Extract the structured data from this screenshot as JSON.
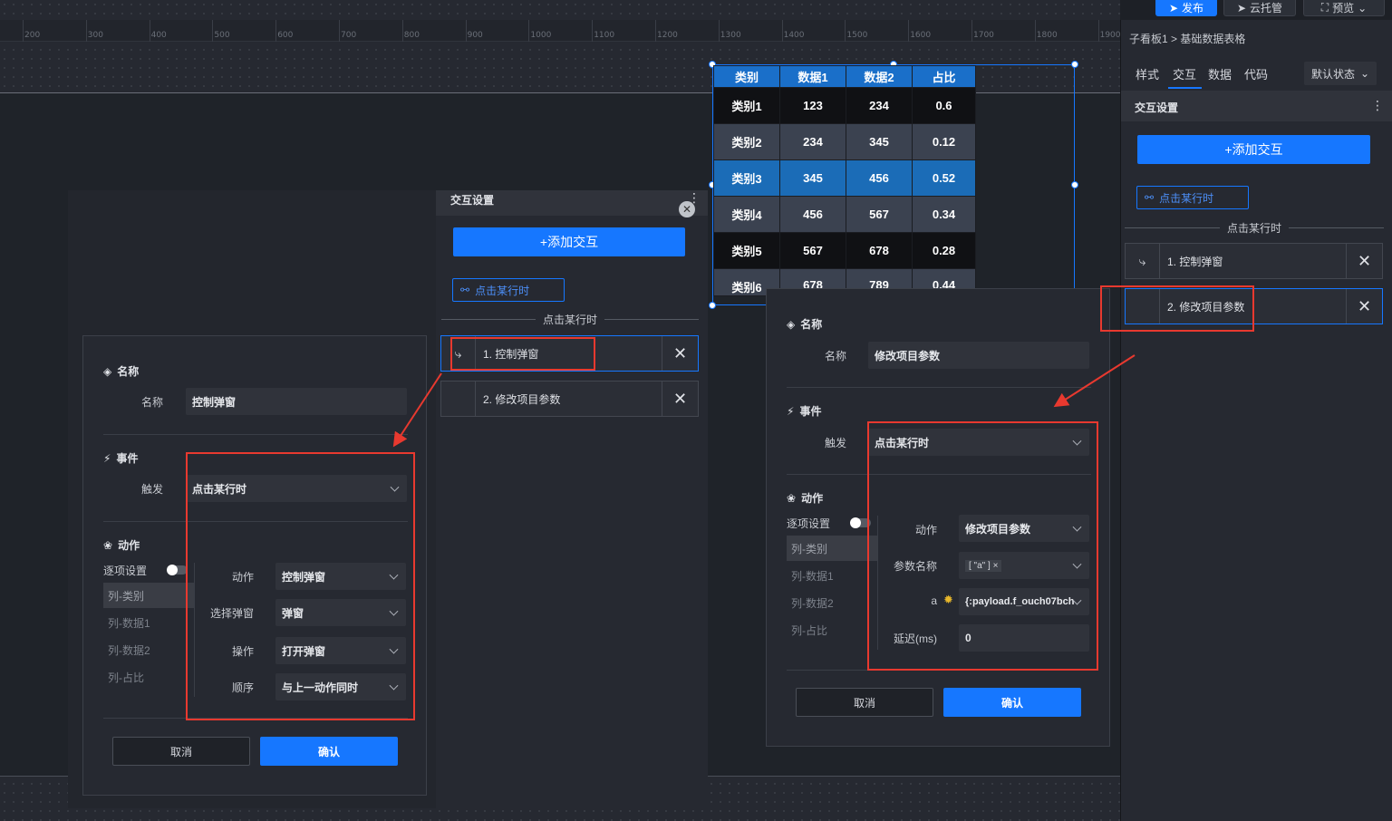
{
  "topbar": {
    "publish": "发布",
    "cloud_host": "云托管",
    "preview": "预览"
  },
  "ruler": {
    "ticks": [
      "200",
      "300",
      "400",
      "500",
      "600",
      "700",
      "800",
      "900",
      "1000",
      "1100",
      "1200",
      "1300",
      "1400",
      "1500",
      "1600",
      "1700",
      "1800",
      "1900"
    ]
  },
  "table": {
    "headers": [
      "类别",
      "数据1",
      "数据2",
      "占比"
    ],
    "rows": [
      [
        "类别1",
        "123",
        "234",
        "0.6"
      ],
      [
        "类别2",
        "234",
        "345",
        "0.12"
      ],
      [
        "类别3",
        "345",
        "456",
        "0.52"
      ],
      [
        "类别4",
        "456",
        "567",
        "0.34"
      ],
      [
        "类别5",
        "567",
        "678",
        "0.28"
      ],
      [
        "类别6",
        "678",
        "789",
        "0.44"
      ]
    ],
    "header_color": "#1a6fc9",
    "row_colors": [
      "#101114",
      "#3b4250",
      "#1b6cb7",
      "#3b4250",
      "#101114",
      "#3b4250"
    ]
  },
  "right_panel": {
    "breadcrumb_parent": "子看板1",
    "breadcrumb_sep": ">",
    "breadcrumb_current": "基础数据表格",
    "tabs": [
      "样式",
      "交互",
      "数据",
      "代码"
    ],
    "active_tab": "交互",
    "state_select": "默认状态",
    "section_title": "交互设置",
    "add_button": "+添加交互",
    "trigger_chip": "点击某行时",
    "group_label": "点击某行时",
    "items": [
      "1. 控制弹窗",
      "2. 修改项目参数"
    ]
  },
  "mid_panel": {
    "section_title": "交互设置",
    "add_button": "+添加交互",
    "trigger_chip": "点击某行时",
    "group_label": "点击某行时",
    "items": [
      "1. 控制弹窗",
      "2. 修改项目参数"
    ]
  },
  "dialog_left": {
    "name_section": "名称",
    "name_label": "名称",
    "name_value": "控制弹窗",
    "event_section": "事件",
    "trigger_label": "触发",
    "trigger_value": "点击某行时",
    "action_section": "动作",
    "per_item_label": "逐项设置",
    "columns": [
      "列-类别",
      "列-数据1",
      "列-数据2",
      "列-占比"
    ],
    "rows": [
      {
        "label": "动作",
        "value": "控制弹窗"
      },
      {
        "label": "选择弹窗",
        "value": "弹窗"
      },
      {
        "label": "操作",
        "value": "打开弹窗"
      },
      {
        "label": "顺序",
        "value": "与上一动作同时"
      }
    ],
    "cancel": "取消",
    "ok": "确认"
  },
  "dialog_right": {
    "name_section": "名称",
    "name_label": "名称",
    "name_value": "修改项目参数",
    "event_section": "事件",
    "trigger_label": "触发",
    "trigger_value": "点击某行时",
    "action_section": "动作",
    "per_item_label": "逐项设置",
    "columns": [
      "列-类别",
      "列-数据1",
      "列-数据2",
      "列-占比"
    ],
    "action_label": "动作",
    "action_value": "修改项目参数",
    "param_label": "参数名称",
    "param_tag": "[ \"a\" ]",
    "a_label": "a",
    "a_value": "{:payload.f_ouch07bch",
    "delay_label": "延迟(ms)",
    "delay_value": "0",
    "cancel": "取消",
    "ok": "确认"
  }
}
